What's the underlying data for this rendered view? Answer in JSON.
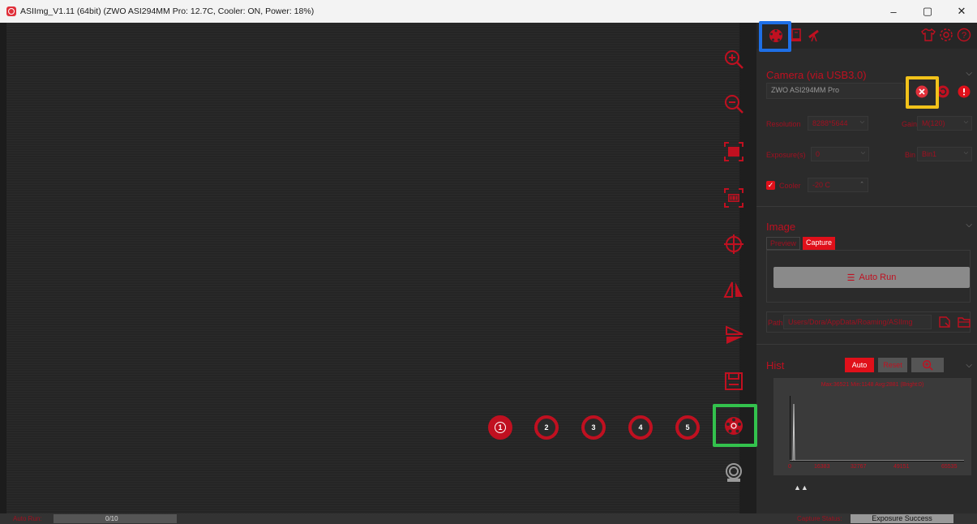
{
  "window": {
    "title": "ASIImg_V1.11 (64bit)  (ZWO ASI294MM Pro: 12.7C, Cooler: ON, Power: 18%)",
    "minimize": "–",
    "restore": "▢",
    "close": "✕"
  },
  "toolbar": {
    "icons": [
      "zoom-in-icon",
      "zoom-out-icon",
      "fit-frame-icon",
      "actual-size-icon",
      "crosshair-icon",
      "flip-horizontal-icon",
      "flip-vertical-icon",
      "save-icon",
      "filter-wheel-icon",
      "webcam-icon"
    ]
  },
  "presets": {
    "items": [
      "1",
      "2",
      "3",
      "4",
      "5"
    ],
    "active": "1"
  },
  "panel": {
    "camera": {
      "title": "Camera (via USB3.0)",
      "device": "ZWO ASI294MM Pro",
      "resolution_label": "Resolution",
      "resolution_value": "8288*5644",
      "gain_label": "Gain",
      "gain_value": "M(120)",
      "exposure_label": "Exposure(s)",
      "exposure_value": "0",
      "bin_label": "Bin",
      "bin_value": "Bin1",
      "cooler_label": "Cooler",
      "cooler_checked": true,
      "cooler_value": "-20 C"
    },
    "image": {
      "title": "Image",
      "tabs": [
        "Preview",
        "Capture"
      ],
      "active_tab": "Capture",
      "auto_run": "Auto Run",
      "path_label": "Path",
      "path_value": "Users/Dora/AppData/Roaming/ASIImg"
    },
    "hist": {
      "title": "Hist",
      "auto": "Auto",
      "reset": "Reset",
      "stats": "Max:36521 Min:1148 Avg:2881 (Bright:0)",
      "ticks": [
        "0",
        "16383",
        "32767",
        "49151",
        "65535"
      ]
    }
  },
  "statusbar": {
    "progress_label": "Auto Run:",
    "progress_value": "0/10",
    "progress_fraction": 0.0,
    "capture_status_label": "Capture Status:",
    "capture_status_value": "Exposure Success"
  },
  "colors": {
    "accent": "#c01020",
    "highlight_blue": "#1e6fe6",
    "highlight_yellow": "#f2c21a",
    "highlight_green": "#33c24d"
  }
}
